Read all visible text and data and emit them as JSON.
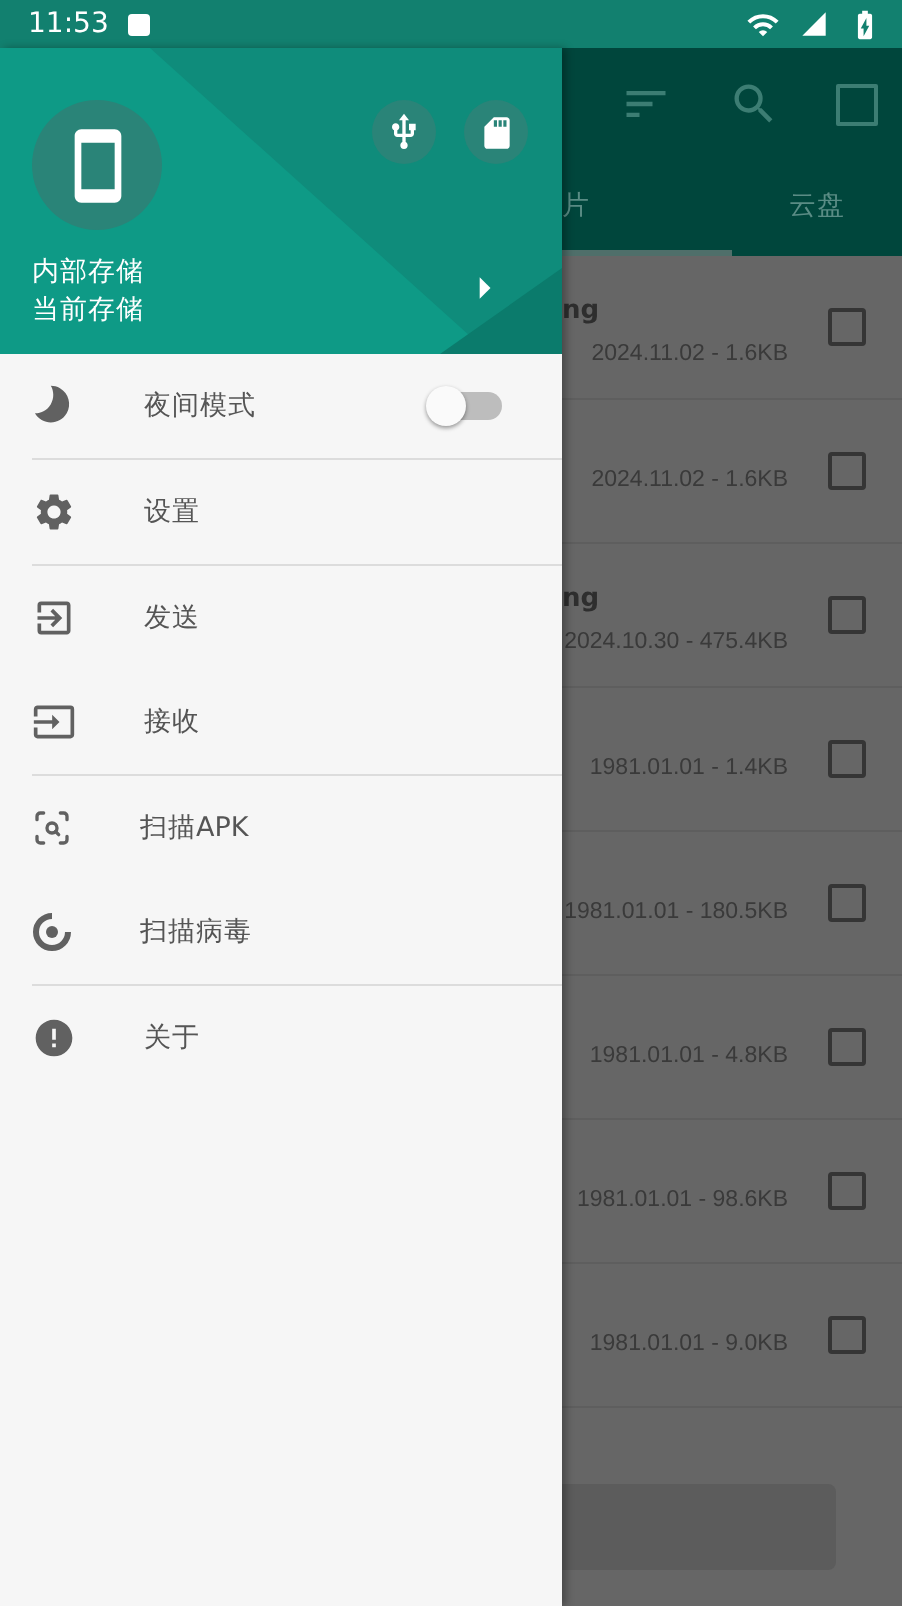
{
  "status_bar": {
    "time": "11:53"
  },
  "drawer": {
    "storage": {
      "name": "内部存储",
      "status": "当前存储"
    },
    "groups": [
      {
        "items": [
          {
            "kind": "switch",
            "label": "夜间模式",
            "on": false
          }
        ]
      },
      {
        "items": [
          {
            "kind": "link",
            "label": "设置"
          }
        ]
      },
      {
        "items": [
          {
            "kind": "link",
            "label": "发送"
          },
          {
            "kind": "link",
            "label": "接收"
          }
        ]
      },
      {
        "items": [
          {
            "kind": "link",
            "label": "扫描APK"
          },
          {
            "kind": "link",
            "label": "扫描病毒"
          }
        ]
      },
      {
        "items": [
          {
            "kind": "link",
            "label": "关于"
          }
        ]
      }
    ]
  },
  "tabs": [
    {
      "label": "片",
      "selected": true
    },
    {
      "label": "云盘",
      "selected": false
    }
  ],
  "files": [
    {
      "name": "ng",
      "meta": "2024.11.02 - 1.6KB",
      "checked": false
    },
    {
      "meta": "2024.11.02 - 1.6KB",
      "checked": false
    },
    {
      "name": "ng",
      "meta": "2024.10.30 - 475.4KB",
      "checked": false
    },
    {
      "meta": "1981.01.01 - 1.4KB",
      "checked": false
    },
    {
      "meta": "1981.01.01 - 180.5KB",
      "checked": false
    },
    {
      "meta": "1981.01.01 - 4.8KB",
      "checked": false
    },
    {
      "meta": "1981.01.01 - 98.6KB",
      "checked": false
    },
    {
      "meta": "1981.01.01 - 9.0KB",
      "checked": false
    }
  ]
}
